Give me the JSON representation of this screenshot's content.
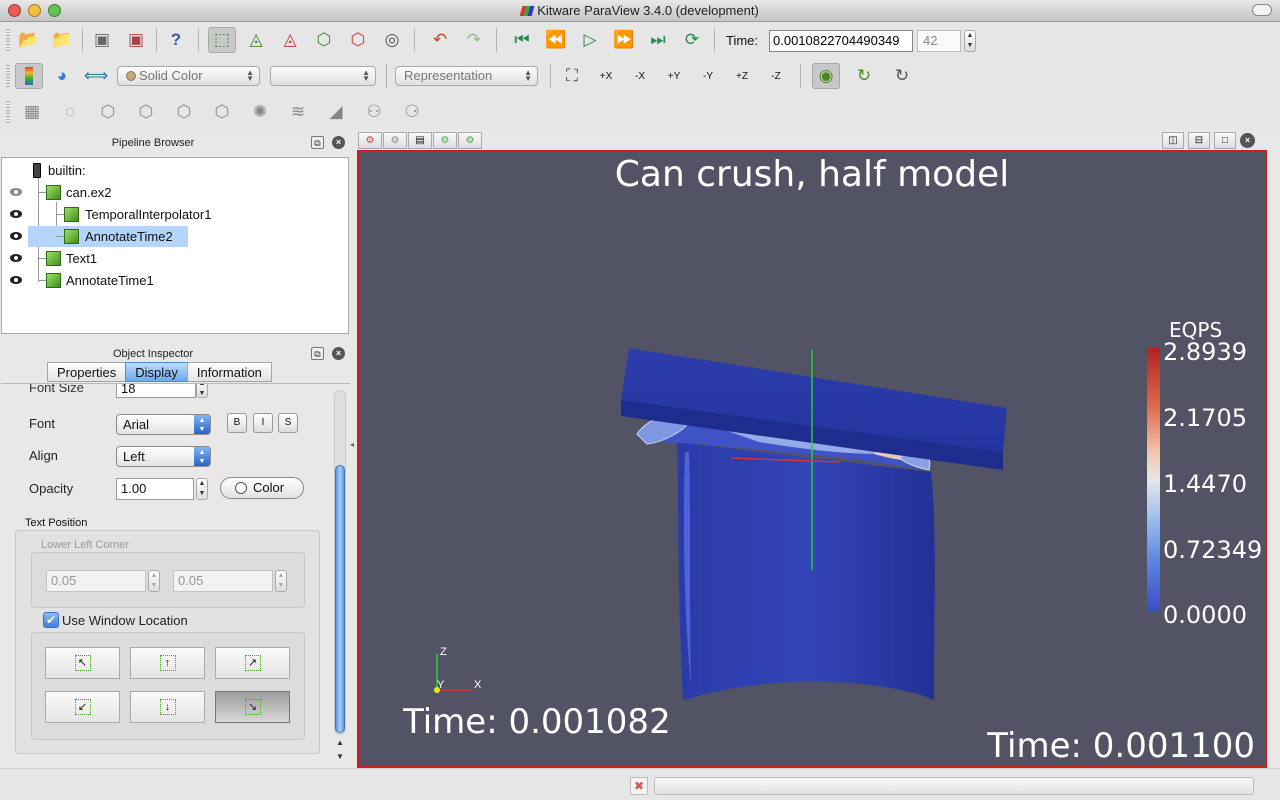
{
  "window": {
    "title": "Kitware ParaView 3.4.0 (development)"
  },
  "toolbar": {
    "color_combo": "Solid Color",
    "array_combo": "",
    "representation_combo": "Representation",
    "time_label": "Time:",
    "time_value": "0.0010822704490349",
    "frame_value": "42",
    "axis_buttons": [
      "+X",
      "-X",
      "+Y",
      "-Y",
      "+Z",
      "-Z"
    ]
  },
  "pipeline": {
    "title": "Pipeline Browser",
    "items": [
      {
        "label": "builtin:"
      },
      {
        "label": "can.ex2"
      },
      {
        "label": "TemporalInterpolator1"
      },
      {
        "label": "AnnotateTime2"
      },
      {
        "label": "Text1"
      },
      {
        "label": "AnnotateTime1"
      }
    ]
  },
  "inspector": {
    "title": "Object Inspector",
    "tabs": [
      "Properties",
      "Display",
      "Information"
    ],
    "font_size_label": "Font Size",
    "font_size_value": "18",
    "font_label": "Font",
    "font_value": "Arial",
    "style_buttons": [
      "B",
      "I",
      "S"
    ],
    "align_label": "Align",
    "align_value": "Left",
    "opacity_label": "Opacity",
    "opacity_value": "1.00",
    "color_button": "Color",
    "text_position_title": "Text Position",
    "lower_left_title": "Lower Left Corner",
    "lower_left_x": "0.05",
    "lower_left_y": "0.05",
    "use_window_location_label": "Use Window Location",
    "use_window_location_checked": true
  },
  "viewport": {
    "title_text": "Can crush, half model",
    "annotation_left": "Time: 0.001082",
    "annotation_right": "Time: 0.001100",
    "legend": {
      "title": "EQPS",
      "values": [
        "2.8939",
        "2.1705",
        "1.4470",
        "0.72349",
        "0.0000"
      ]
    },
    "axes": {
      "x": "X",
      "y": "Y",
      "z": "Z"
    }
  },
  "colors": {
    "viewport_background": "#525466",
    "active_view_border": "#d21c1c",
    "selection": "#b5d5ff",
    "tab_selected": "#6ca9ec"
  }
}
